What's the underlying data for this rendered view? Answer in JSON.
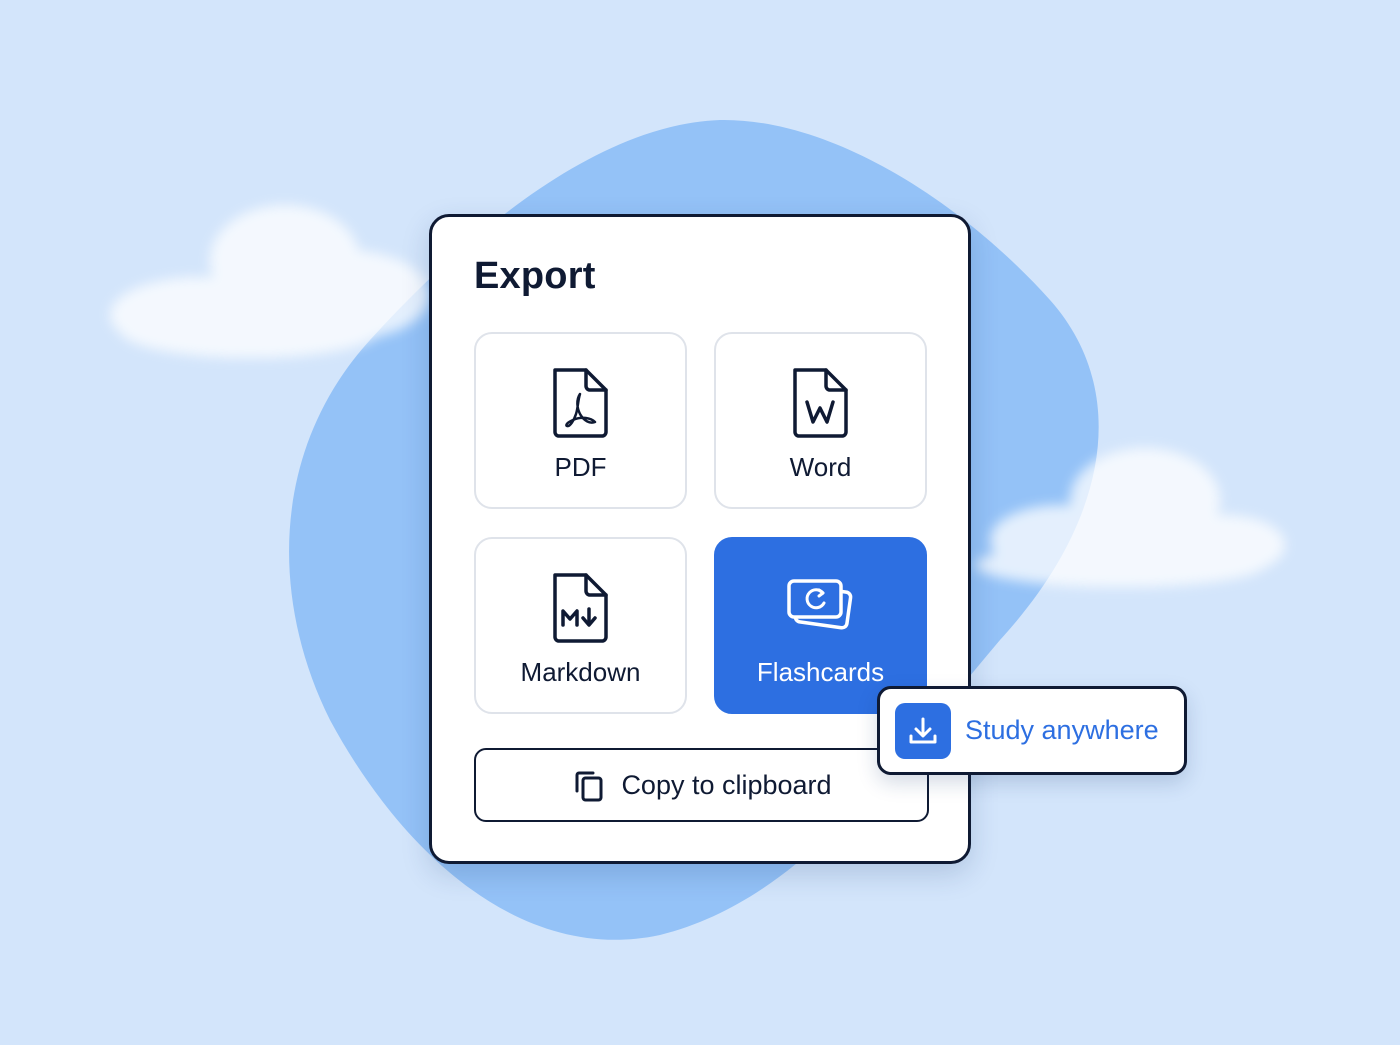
{
  "panel": {
    "title": "Export",
    "options": [
      {
        "label": "PDF",
        "icon": "pdf-file-icon"
      },
      {
        "label": "Word",
        "icon": "word-file-icon"
      },
      {
        "label": "Markdown",
        "icon": "markdown-file-icon"
      },
      {
        "label": "Flashcards",
        "icon": "flashcards-icon",
        "selected": true
      }
    ],
    "copy_button": {
      "label": "Copy to clipboard",
      "icon": "copy-icon"
    }
  },
  "tooltip": {
    "label": "Study anywhere",
    "icon": "download-icon"
  },
  "colors": {
    "background": "#d3e5fb",
    "blob": "#94c2f7",
    "accent": "#2d6fe1",
    "ink": "#0f1a33",
    "tile_border": "#dfe3ea"
  }
}
